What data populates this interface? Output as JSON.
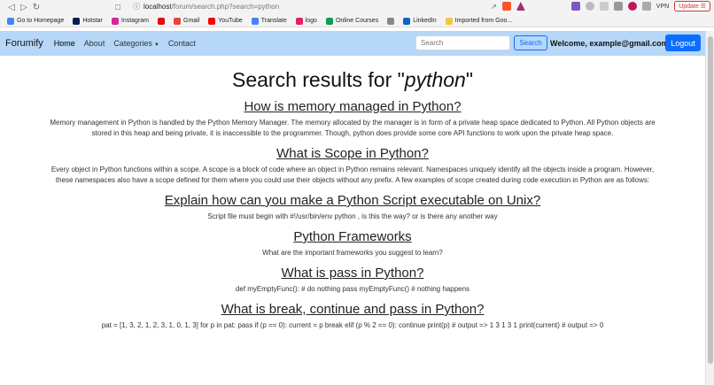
{
  "browser": {
    "url_host": "localhost",
    "url_path": "/forum/search.php?search=python",
    "vpn_label": "VPN",
    "update_label": "Update"
  },
  "bookmarks": [
    {
      "label": "Go to Homepage",
      "icon": "google-icon",
      "color": "#4285f4"
    },
    {
      "label": "Hotstar",
      "icon": "hotstar-icon",
      "color": "#0b1d4d"
    },
    {
      "label": "Instagram",
      "icon": "instagram-icon",
      "color": "#d6249f"
    },
    {
      "label": "",
      "icon": "netflix-icon",
      "color": "#e50914"
    },
    {
      "label": "Gmail",
      "icon": "gmail-icon",
      "color": "#ea4335"
    },
    {
      "label": "YouTube",
      "icon": "youtube-icon",
      "color": "#ff0000"
    },
    {
      "label": "Translate",
      "icon": "translate-icon",
      "color": "#4285f4"
    },
    {
      "label": "logo",
      "icon": "logo-icon",
      "color": "#e91e63"
    },
    {
      "label": "Online Courses",
      "icon": "drive-icon",
      "color": "#0f9d58"
    },
    {
      "label": "",
      "icon": "photo-icon",
      "color": "#888888"
    },
    {
      "label": "LinkedIn",
      "icon": "linkedin-icon",
      "color": "#0a66c2"
    },
    {
      "label": "Imported from Goo...",
      "icon": "folder-icon",
      "color": "#f4c542"
    }
  ],
  "navbar": {
    "brand": "Forumify",
    "links": [
      "Home",
      "About",
      "Categories",
      "Contact"
    ],
    "search_placeholder": "Search",
    "search_button": "Search",
    "welcome": "Welcome, example@gmail.com",
    "logout": "Logout"
  },
  "search": {
    "title_prefix": "Search results for \"",
    "query": "python",
    "title_suffix": "\""
  },
  "results": [
    {
      "title": "How is memory managed in Python?",
      "desc": "Memory management in Python is handled by the Python Memory Manager. The memory allocated by the manager is in form of a private heap space dedicated to Python. All Python objects are stored in this heap and being private, it is inaccessible to the programmer. Though, python does provide some core API functions to work upon the private heap space."
    },
    {
      "title": "What is Scope in Python?",
      "desc": "Every object in Python functions within a scope. A scope is a block of code where an object in Python remains relevant. Namespaces uniquely identify all the objects inside a program. However, these namespaces also have a scope defined for them where you could use their objects without any prefix. A few examples of scope created during code execution in Python are as follows:"
    },
    {
      "title": "Explain how can you make a Python Script executable on Unix?",
      "desc": "Script file must begin with #!/usr/bin/env python , is this the way? or is there any another way"
    },
    {
      "title": "Python Frameworks",
      "desc": "What are the important frameworks you suggest to learn?"
    },
    {
      "title": "What is pass in Python?",
      "desc": "def myEmptyFunc(): # do nothing pass myEmptyFunc() # nothing happens"
    },
    {
      "title": "What is break, continue and pass in Python?",
      "desc": "pat = [1, 3, 2, 1, 2, 3, 1, 0, 1, 3] for p in pat: pass if (p == 0): current = p break elif (p % 2 == 0): continue print(p) # output => 1 3 1 3 1 print(current) # output => 0"
    }
  ]
}
